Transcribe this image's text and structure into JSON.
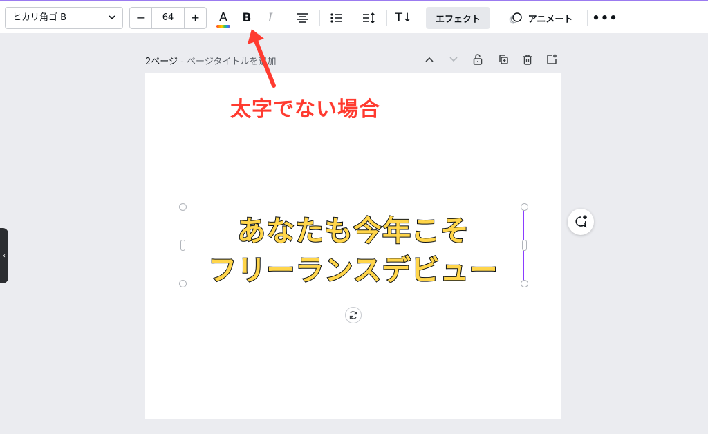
{
  "toolbar": {
    "font_family": "ヒカリ角ゴ B",
    "font_size": "64",
    "decrease_label": "−",
    "increase_label": "+",
    "color_letter": "A",
    "bold_label": "B",
    "italic_label": "I",
    "text_direction_label": "T↓",
    "effect_label": "エフェクト",
    "animate_label": "アニメート",
    "more_label": "•••"
  },
  "page": {
    "number_label": "2ページ",
    "separator": " - ",
    "title_placeholder": "ページタイトルを追加"
  },
  "annotation": {
    "text": "太字でない場合",
    "color": "#ff3b30"
  },
  "canvas_text": {
    "line1": "あなたも今年こそ",
    "line2": "フリーランスデビュー",
    "fill_color": "#ffd54a",
    "stroke_color": "#0e1318"
  },
  "colors": {
    "selection": "#8b3dff",
    "background": "#ebecf0"
  },
  "side_tab": {
    "label": "‹"
  }
}
